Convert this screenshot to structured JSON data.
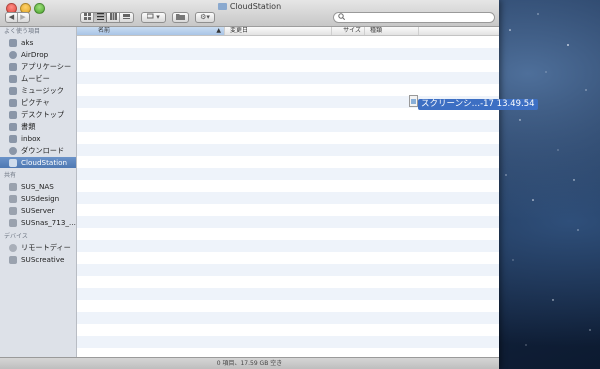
{
  "window": {
    "title": "CloudStation"
  },
  "toolbar": {
    "back_label": "◀",
    "forward_label": "▶",
    "search_placeholder": "",
    "action_label": "⚙▾",
    "arrange_label": "▾"
  },
  "sidebar": {
    "favorites_header": "よく使う項目",
    "favorites": [
      {
        "label": "aks",
        "icon": "home-icon"
      },
      {
        "label": "AirDrop",
        "icon": "airdrop-icon"
      },
      {
        "label": "アプリケーシー",
        "icon": "applications-icon"
      },
      {
        "label": "ムービー",
        "icon": "movies-icon"
      },
      {
        "label": "ミュージック",
        "icon": "music-icon"
      },
      {
        "label": "ピクチャ",
        "icon": "pictures-icon"
      },
      {
        "label": "デスクトップ",
        "icon": "desktop-icon"
      },
      {
        "label": "書類",
        "icon": "documents-icon"
      },
      {
        "label": "inbox",
        "icon": "folder-icon"
      },
      {
        "label": "ダウンロード",
        "icon": "downloads-icon"
      },
      {
        "label": "CloudStation",
        "icon": "folder-icon"
      }
    ],
    "shared_header": "共有",
    "shared": [
      {
        "label": "SUS_NAS",
        "icon": "server-icon"
      },
      {
        "label": "SUSdesign",
        "icon": "server-icon"
      },
      {
        "label": "SUServer",
        "icon": "server-icon"
      },
      {
        "label": "SUSnas_713_...",
        "icon": "server-icon"
      }
    ],
    "devices_header": "デバイス",
    "devices": [
      {
        "label": "リモートディー",
        "icon": "disc-icon"
      },
      {
        "label": "SUScreative",
        "icon": "drive-icon"
      }
    ]
  },
  "columns": {
    "name": "名前",
    "modified": "変更日",
    "size": "サイズ",
    "kind": "種類"
  },
  "status": {
    "text": "0 項目、17.59 GB 空き"
  },
  "drag_item": {
    "label": "スクリーンシ…-17 13.49.54"
  },
  "colors": {
    "selection": "#4e78b2",
    "drag_label": "#3d6fc3",
    "row_alt": "#eef3fa"
  }
}
